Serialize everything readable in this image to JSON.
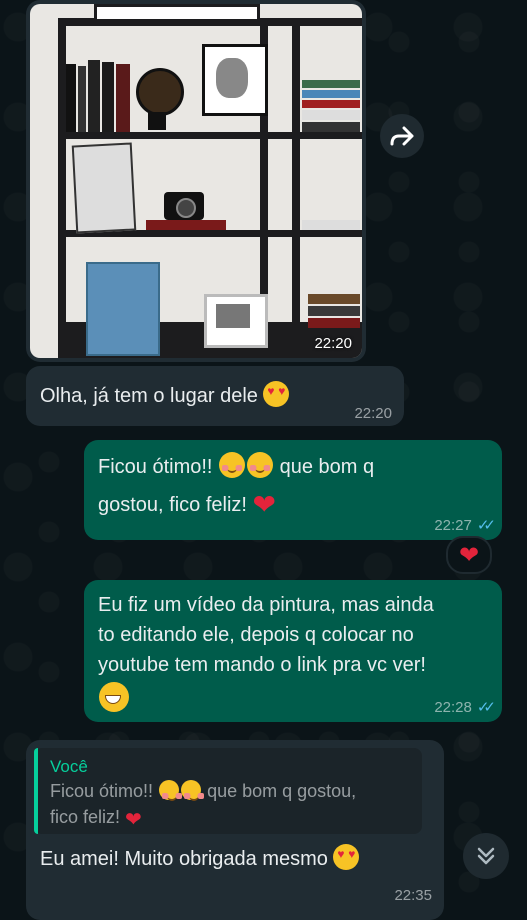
{
  "messages": [
    {
      "id": "photo",
      "type": "image",
      "direction": "incoming",
      "time": "22:20"
    },
    {
      "id": "m1",
      "direction": "incoming",
      "text": "Olha, já tem o lugar dele",
      "time": "22:20"
    },
    {
      "id": "m2",
      "direction": "outgoing",
      "text_part1": "Ficou ótimo!!",
      "text_part2": "que bom q",
      "text_line2": "gostou, fico feliz!",
      "time": "22:27",
      "status": "read",
      "reaction": "heart"
    },
    {
      "id": "m3",
      "direction": "outgoing",
      "lines": [
        "Eu fiz um vídeo da pintura, mas ainda",
        "to editando ele, depois q colocar no",
        "youtube tem mando o link pra vc ver!"
      ],
      "time": "22:28",
      "status": "read"
    },
    {
      "id": "m4",
      "direction": "incoming",
      "quote": {
        "author": "Você",
        "text_part1": "Ficou ótimo!!",
        "text_part2": "que bom q gostou,",
        "text_line2": "fico feliz!"
      },
      "text": "Eu amei! Muito obrigada mesmo",
      "time": "22:35"
    }
  ],
  "icons": {
    "forward": "forward-icon",
    "scroll_down": "chevron-double-down-icon",
    "read": "double-check-icon"
  },
  "colors": {
    "incoming": "#202c33",
    "outgoing": "#005c4b",
    "read_ticks": "#53bdeb",
    "quote_accent": "#06cf9c"
  }
}
